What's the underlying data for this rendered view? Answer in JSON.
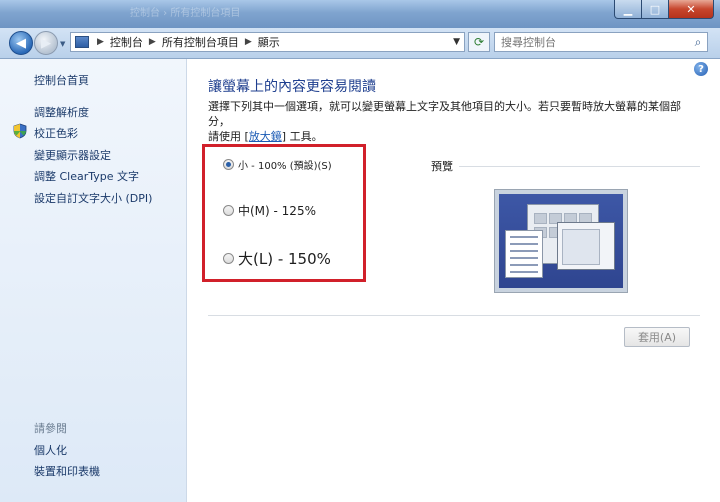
{
  "window": {
    "title_ghost": "控制台 › 所有控制台項目",
    "minimize_glyph": "▁",
    "maximize_glyph": "□",
    "close_glyph": "✕"
  },
  "navbar": {
    "breadcrumbs": [
      "控制台",
      "所有控制台項目",
      "顯示"
    ],
    "breadcrumb_separator": "▶",
    "dropdown_glyph": "▼",
    "refresh_glyph": "⟳",
    "search_placeholder": "搜尋控制台",
    "search_glyph": "⌕"
  },
  "sidebar": {
    "home": "控制台首頁",
    "items": [
      "調整解析度",
      "校正色彩",
      "變更顯示器設定",
      "調整 ClearType 文字",
      "設定自訂文字大小 (DPI)"
    ],
    "see_also_label": "請參閱",
    "see_also": [
      "個人化",
      "裝置和印表機"
    ]
  },
  "main": {
    "help_glyph": "?",
    "title": "讓螢幕上的內容更容易閱讀",
    "desc_line1": "選擇下列其中一個選項，就可以變更螢幕上文字及其他項目的大小。若只要暫時放大螢幕的某個部分，",
    "desc_line2_before": "請使用 [",
    "desc_link": "放大鏡",
    "desc_line2_after": "] 工具。",
    "options": [
      {
        "label": "小 - 100% (預設)(S)",
        "selected": true
      },
      {
        "label": "中(M) - 125%",
        "selected": false
      },
      {
        "label": "大(L) - 150%",
        "selected": false
      }
    ],
    "preview_label": "預覽",
    "apply_label": "套用(A)"
  },
  "colors": {
    "accent_title": "#1f3f8f",
    "highlight_box": "#d1202a",
    "link": "#1a5ab4"
  }
}
